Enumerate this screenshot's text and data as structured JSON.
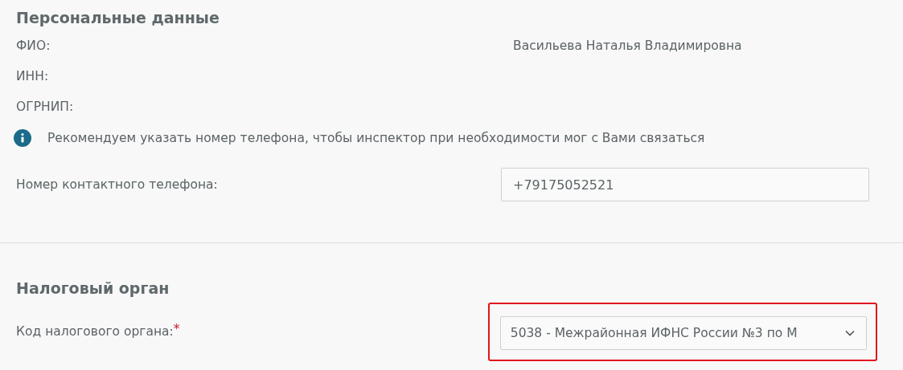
{
  "personal": {
    "title": "Персональные данные",
    "fields": [
      {
        "label": "ФИО:",
        "value": "Васильева Наталья Владимировна"
      },
      {
        "label": "ИНН:"
      },
      {
        "label": "ОГРНИП:"
      }
    ],
    "info": "Рекомендуем указать номер телефона, чтобы инспектор при необходимости мог с Вами связаться",
    "phone": {
      "label": "Номер контактного телефона:",
      "value": "+79175052521"
    }
  },
  "tax": {
    "title": "Налоговый орган",
    "code": {
      "label": "Код налогового органа:",
      "required_mark": "*",
      "value": "5038 - Межрайонная ИФНС России №3 по М",
      "highlighted": true
    }
  }
}
